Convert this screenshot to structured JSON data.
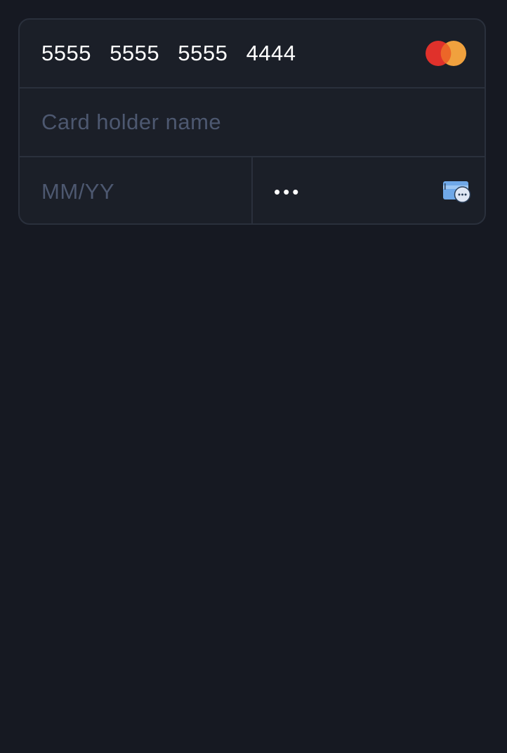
{
  "card_number": {
    "value": "5555  5555  5555  4444",
    "brand_icon": "mastercard-logo-icon"
  },
  "card_holder": {
    "placeholder": "Card holder name"
  },
  "expiry": {
    "placeholder": "MM/YY"
  },
  "cvc": {
    "value": "•••",
    "icon": "card-cvc-icon"
  },
  "colors": {
    "background": "#161922",
    "card_bg": "#1b1f28",
    "border": "#2a303c",
    "placeholder": "#4d5870",
    "text": "#ffffff",
    "mastercard_red": "#e0312b",
    "mastercard_orange": "#f0a13e",
    "cvc_card_blue": "#6fa8e8"
  }
}
